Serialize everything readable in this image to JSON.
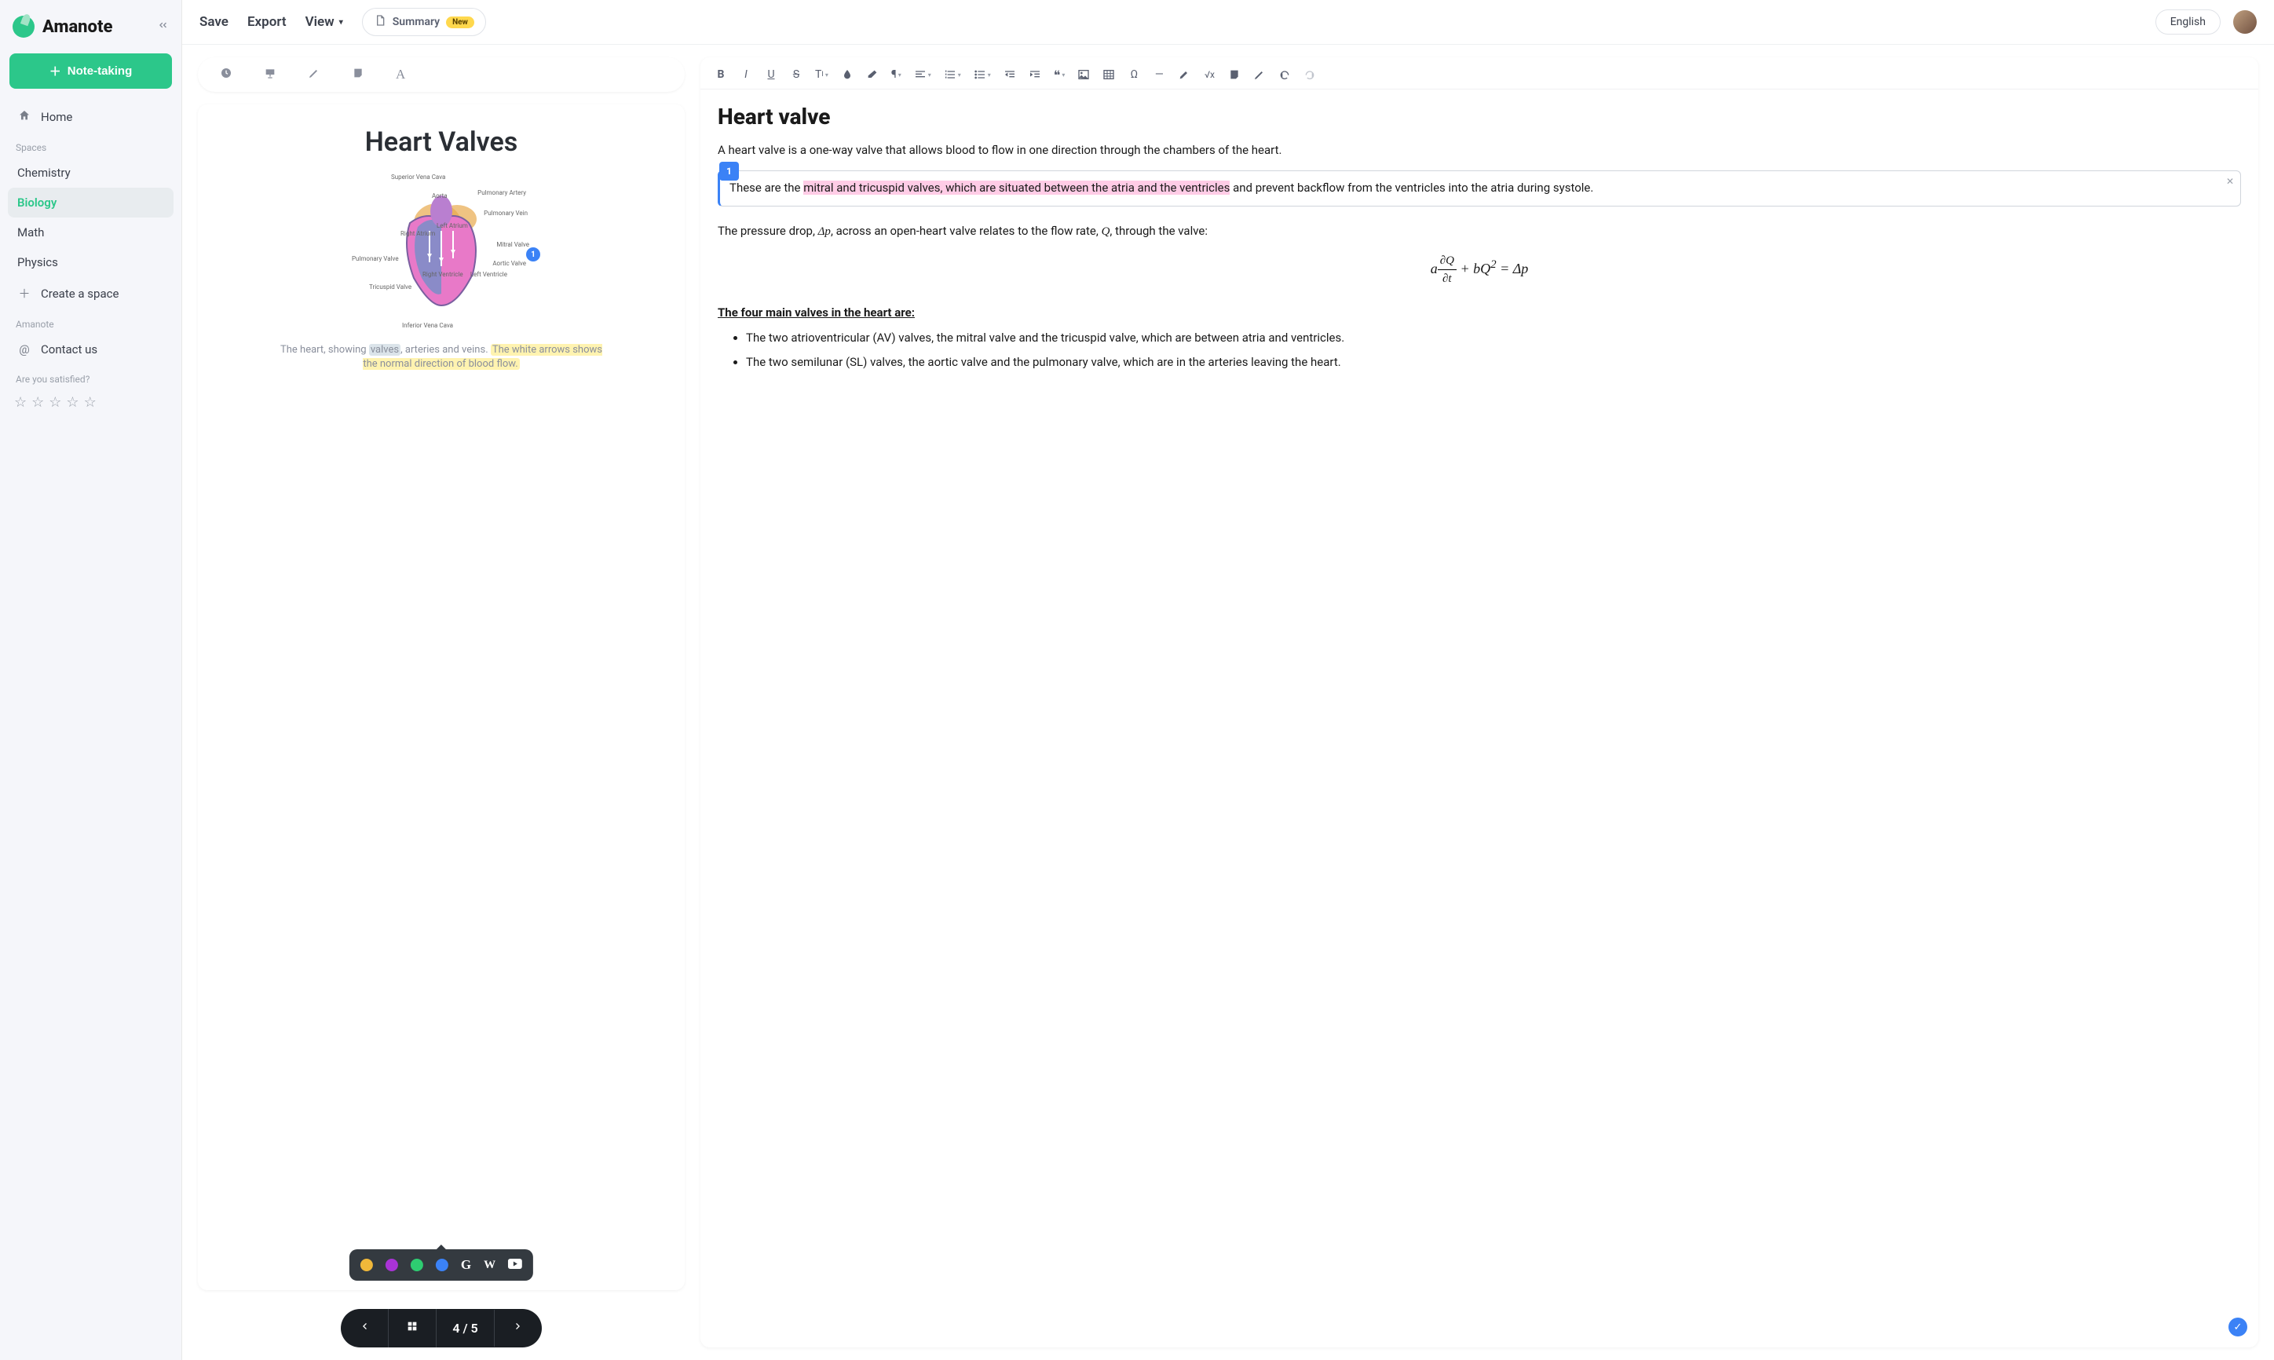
{
  "app": {
    "name": "Amanote"
  },
  "sidebar": {
    "primary_action": "Note-taking",
    "items": [
      {
        "label": "Home",
        "icon": "home-icon"
      },
      {
        "label": "Chemistry"
      },
      {
        "label": "Biology"
      },
      {
        "label": "Math"
      },
      {
        "label": "Physics"
      },
      {
        "label": "Create a space",
        "icon": "plus-icon"
      }
    ],
    "spaces_label": "Spaces",
    "amanote_label": "Amanote",
    "contact": "Contact us",
    "satisfied_label": "Are you satisfied?"
  },
  "topbar": {
    "save": "Save",
    "export": "Export",
    "view": "View",
    "summary": "Summary",
    "summary_badge": "New",
    "language": "English"
  },
  "slide": {
    "title": "Heart Valves",
    "marker": "1",
    "caption_pre": "The heart, showing ",
    "caption_valves": "valves",
    "caption_mid": ", arteries and veins. ",
    "caption_hl": "The white arrows shows the normal direction of blood flow.",
    "heart_labels": {
      "svc": "Superior Vena Cava",
      "aorta": "Aorta",
      "pa": "Pulmonary Artery",
      "pv": "Pulmonary Vein",
      "mitral": "Mitral Valve",
      "aortic": "Aortic Valve",
      "lv": "Left Ventricle",
      "ra": "Right Atrium",
      "la": "Left Atrium",
      "pvalve": "Pulmonary Valve",
      "tri": "Tricuspid Valve",
      "rv": "Right Ventricle",
      "ivc": "Inferior Vena Cava"
    },
    "pager": {
      "current": "4",
      "sep": " / ",
      "total": "5"
    }
  },
  "popup": {
    "colors": [
      "#f0b83a",
      "#a933d6",
      "#2ecc71",
      "#3b82f6"
    ]
  },
  "editor": {
    "heading": "Heart valve",
    "intro": "A heart valve is a one-way valve that allows blood to flow in one direction through the chambers of the heart.",
    "note": {
      "badge": "1",
      "pre": "These are the ",
      "hl": "mitral and tricuspid valves, which are situated between the atria and the ventricles",
      "post": " and prevent backflow from the ventricles into the atria during systole."
    },
    "pressure_pre": "The pressure drop, ",
    "dp": "Δp",
    "pressure_mid": ", across an open-heart valve relates to the flow rate, ",
    "q": "Q",
    "pressure_post": ", through the valve:",
    "eq": {
      "a": "a",
      "num": "∂Q",
      "den": "∂t",
      "plus": " + bQ",
      "sq": "2",
      "eq": " = Δp"
    },
    "subheading": "The four main valves in the heart are:",
    "bullets": [
      "The two atrioventricular (AV) valves, the mitral valve and the tricuspid valve, which are between atria and ventricles.",
      "The two semilunar (SL) valves, the aortic valve and the pulmonary valve, which are in the arteries leaving the heart."
    ]
  }
}
